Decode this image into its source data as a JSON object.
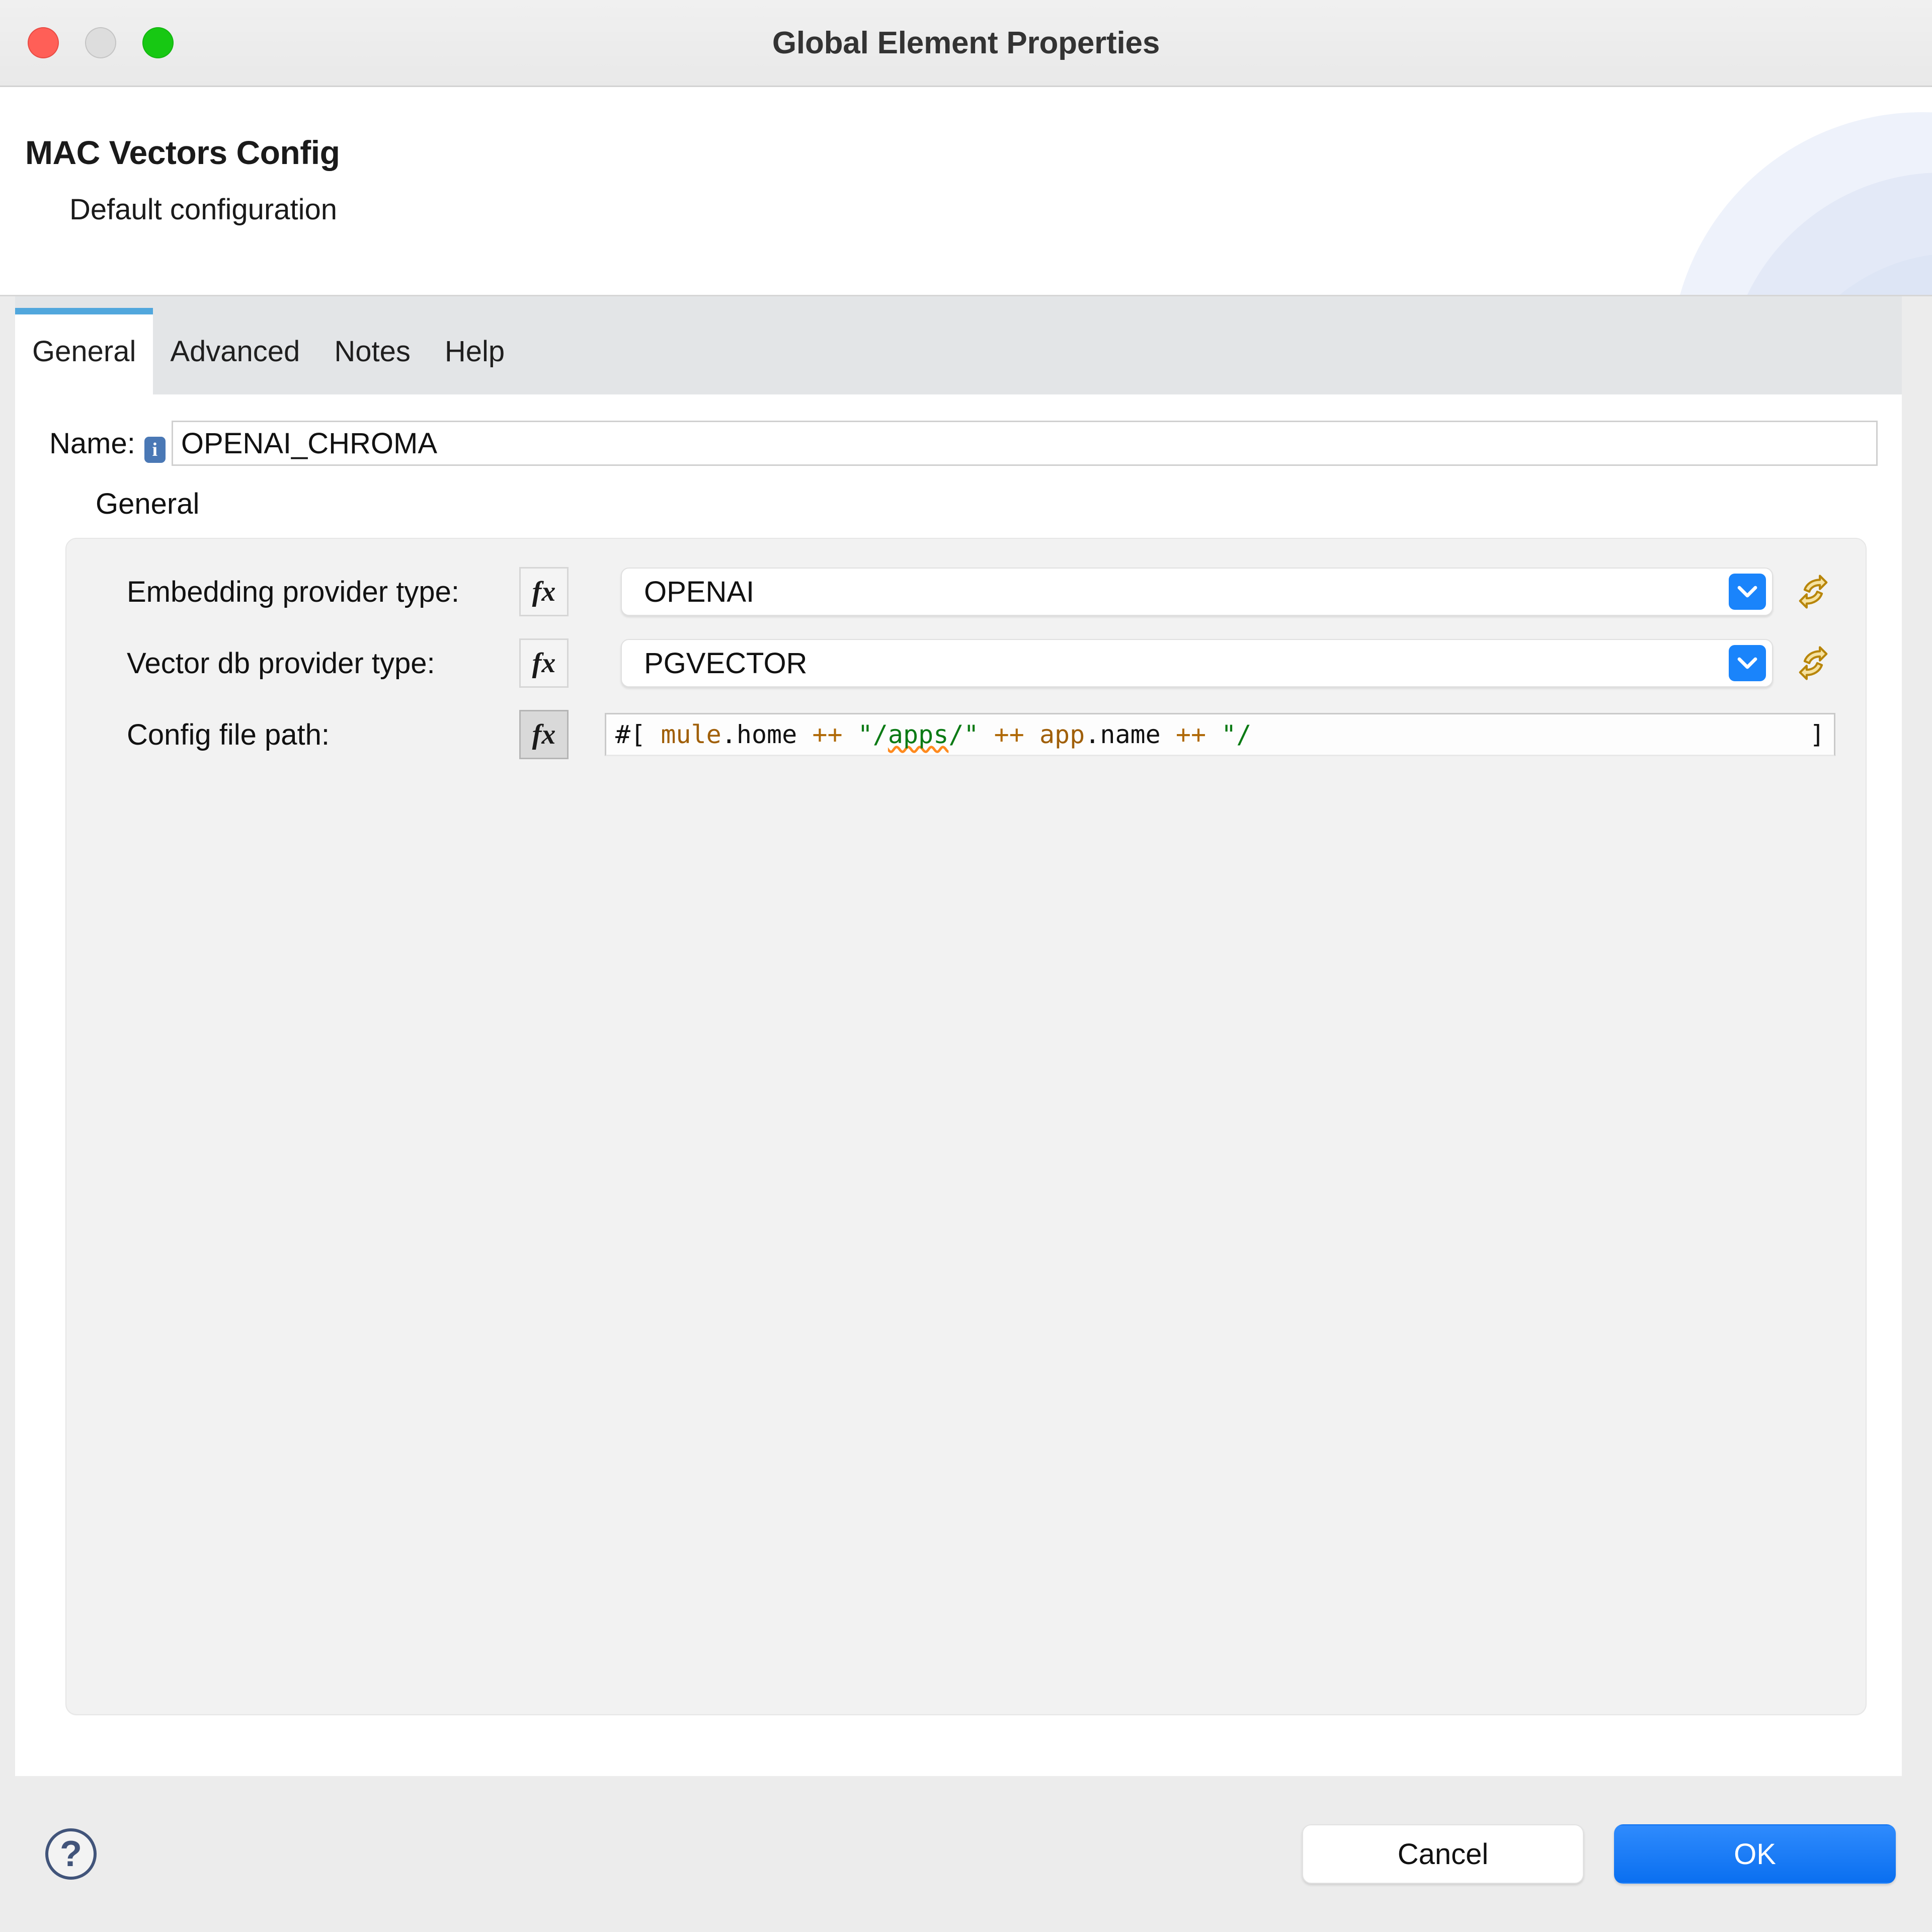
{
  "window": {
    "title": "Global Element Properties",
    "traffic_lights": [
      "close",
      "minimize",
      "maximize"
    ]
  },
  "header": {
    "title": "MAC Vectors Config",
    "subtitle": "Default configuration"
  },
  "tabs": [
    {
      "label": "General",
      "active": true
    },
    {
      "label": "Advanced",
      "active": false
    },
    {
      "label": "Notes",
      "active": false
    },
    {
      "label": "Help",
      "active": false
    }
  ],
  "name_field": {
    "label": "Name:",
    "value": "OPENAI_CHROMA",
    "placeholder": "",
    "info_glyph": "i"
  },
  "group": {
    "caption": "General",
    "fields": [
      {
        "label": "Embedding provider type:",
        "fx_label": "fx",
        "fx_pressed": false,
        "control": "combo",
        "value": "OPENAI",
        "has_refresh": true
      },
      {
        "label": "Vector db provider type:",
        "fx_label": "fx",
        "fx_pressed": false,
        "control": "combo",
        "value": "PGVECTOR",
        "has_refresh": true
      },
      {
        "label": "Config file path:",
        "fx_label": "fx",
        "fx_pressed": true,
        "control": "expression",
        "value": "#[ mule.home ++ \"/apps/\" ++ app.name ++ \"/",
        "closing_bracket": "]",
        "tokens": [
          {
            "text": "#[ ",
            "kind": "plain"
          },
          {
            "text": "mule",
            "kind": "ident"
          },
          {
            "text": ".home ",
            "kind": "plain"
          },
          {
            "text": "++ ",
            "kind": "op"
          },
          {
            "text": "\"/",
            "kind": "str"
          },
          {
            "text": "apps",
            "kind": "squiggle"
          },
          {
            "text": "/\" ",
            "kind": "str"
          },
          {
            "text": "++ ",
            "kind": "op"
          },
          {
            "text": "app",
            "kind": "ident"
          },
          {
            "text": ".name ",
            "kind": "plain"
          },
          {
            "text": "++ ",
            "kind": "op"
          },
          {
            "text": "\"/",
            "kind": "str"
          }
        ]
      }
    ]
  },
  "footer": {
    "help_glyph": "?",
    "cancel_label": "Cancel",
    "ok_label": "OK"
  },
  "colors": {
    "accent_blue": "#1a84fb",
    "tab_underline": "#51a7dd",
    "ok_button": "#0a6ff0",
    "info_icon": "#4a78b5",
    "help_icon": "#41547a",
    "refresh_icon": "#c98a10",
    "string_token": "#0a7a14",
    "ident_token": "#a05f08"
  }
}
